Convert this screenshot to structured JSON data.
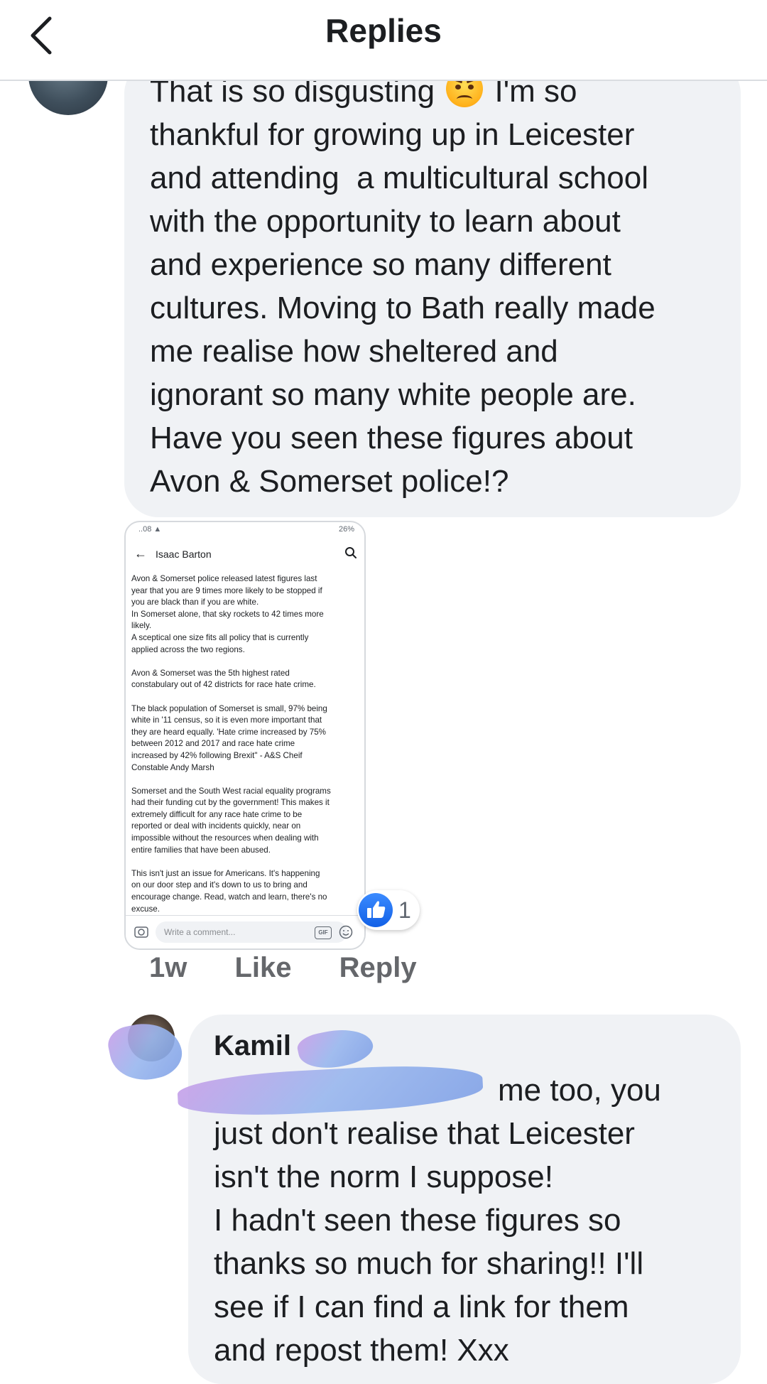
{
  "header": {
    "title": "Replies"
  },
  "comment1": {
    "text_before_emoji": "That is so disgusting ",
    "emoji": "angry-face-emoji",
    "text_after_emoji": " I'm so\nthankful for growing up in Leicester\nand attending  a multicultural school\nwith the opportunity to learn about\nand experience so many different\ncultures. Moving to Bath really made\nme realise how sheltered and\nignorant so many white people are.\nHave you seen these figures about\nAvon & Somerset police!?",
    "reactions": {
      "icon": "thumbs-up-icon",
      "count": "1"
    },
    "actions": {
      "time": "1w",
      "like": "Like",
      "reply": "Reply"
    }
  },
  "shared_screenshot": {
    "status_left": "..08 ▲",
    "status_right": "26%",
    "author": "Isaac Barton",
    "body": "Avon & Somerset police released latest figures last\nyear that you are 9 times more likely to be stopped if\nyou are black than if you are white.\nIn Somerset alone, that sky rockets to 42 times more\nlikely.\nA sceptical one size fits all policy that is currently\napplied across the two regions.\n\nAvon & Somerset was the 5th highest rated\nconstabulary out of 42 districts for race hate crime.\n\nThe black population of Somerset is small, 97% being\nwhite in '11 census, so it is even more important that\nthey are heard equally. 'Hate crime increased by 75%\nbetween 2012 and 2017 and race hate crime\nincreased by 42% following Brexit\" - A&S Cheif\nConstable Andy Marsh\n\nSomerset and the South West racial equality programs\nhad their funding cut by the government! This makes it\nextremely difficult for any race hate crime to be\nreported or deal with incidents quickly, near on\nimpossible without the resources when dealing with\nentire families that have been abused.\n\nThis isn't just an issue for Americans. It's happening\non our door step and it's down to us to bring and\nencourage change. Read, watch and learn, there's no\nexcuse.",
    "compose_placeholder": "Write a comment...",
    "gif_label": "GIF"
  },
  "comment2": {
    "author": "Kamil",
    "text": "me too, you\njust don't realise that Leicester\nisn't the norm I suppose!\nI hadn't seen these figures so\nthanks so much for sharing!! I'll\nsee if I can find a link for them\nand repost them! Xxx"
  }
}
